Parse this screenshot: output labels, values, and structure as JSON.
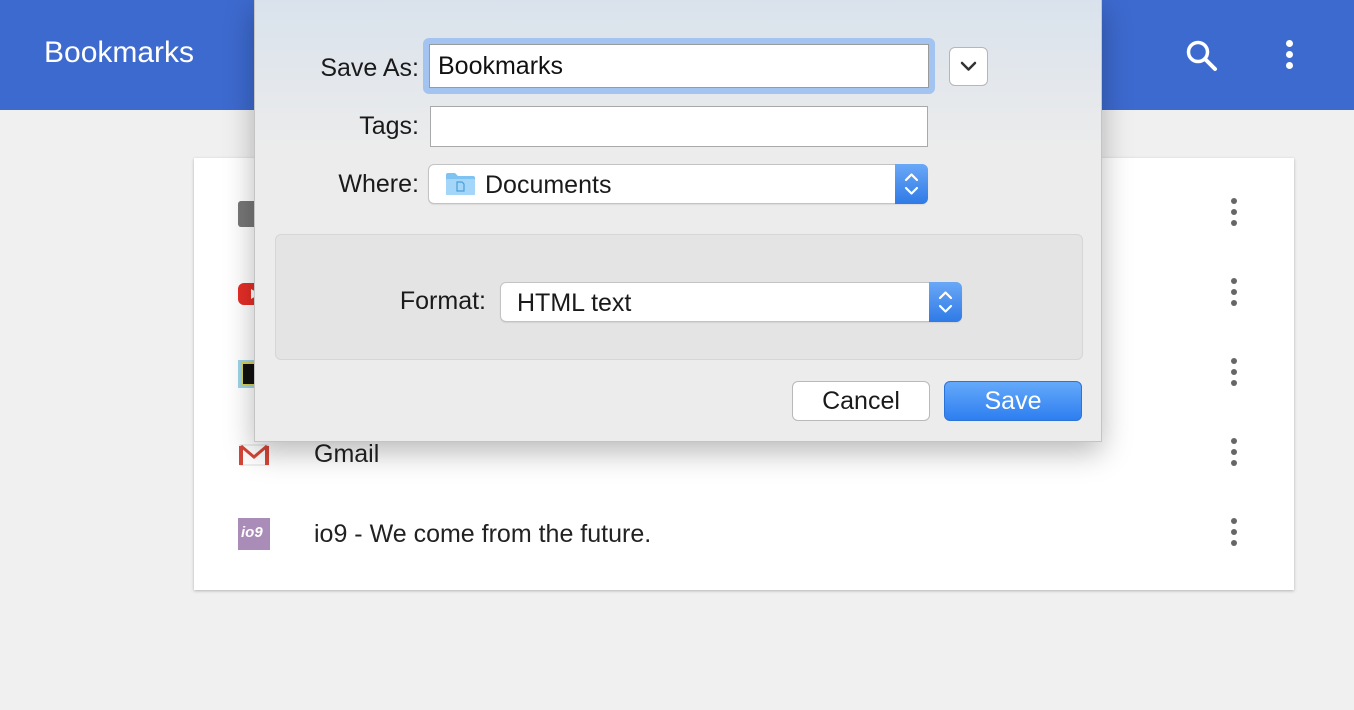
{
  "app": {
    "title": "Bookmarks",
    "bar_color": "#3d6acf"
  },
  "bookmarks": [
    {
      "title": "",
      "icon": "folder-icon"
    },
    {
      "title": "",
      "icon": "youtube-icon"
    },
    {
      "title": "",
      "icon": "site-favicon"
    },
    {
      "title": "Gmail",
      "icon": "gmail-icon"
    },
    {
      "title": "io9 - We come from the future.",
      "icon": "io9-icon",
      "icon_text": "io9"
    }
  ],
  "dialog": {
    "save_as_label": "Save As:",
    "save_as_value": "Bookmarks",
    "tags_label": "Tags:",
    "tags_value": "",
    "where_label": "Where:",
    "where_value": "Documents",
    "format_label": "Format:",
    "format_value": "HTML text",
    "cancel_label": "Cancel",
    "save_label": "Save",
    "accent_color": "#2e7ef0"
  }
}
